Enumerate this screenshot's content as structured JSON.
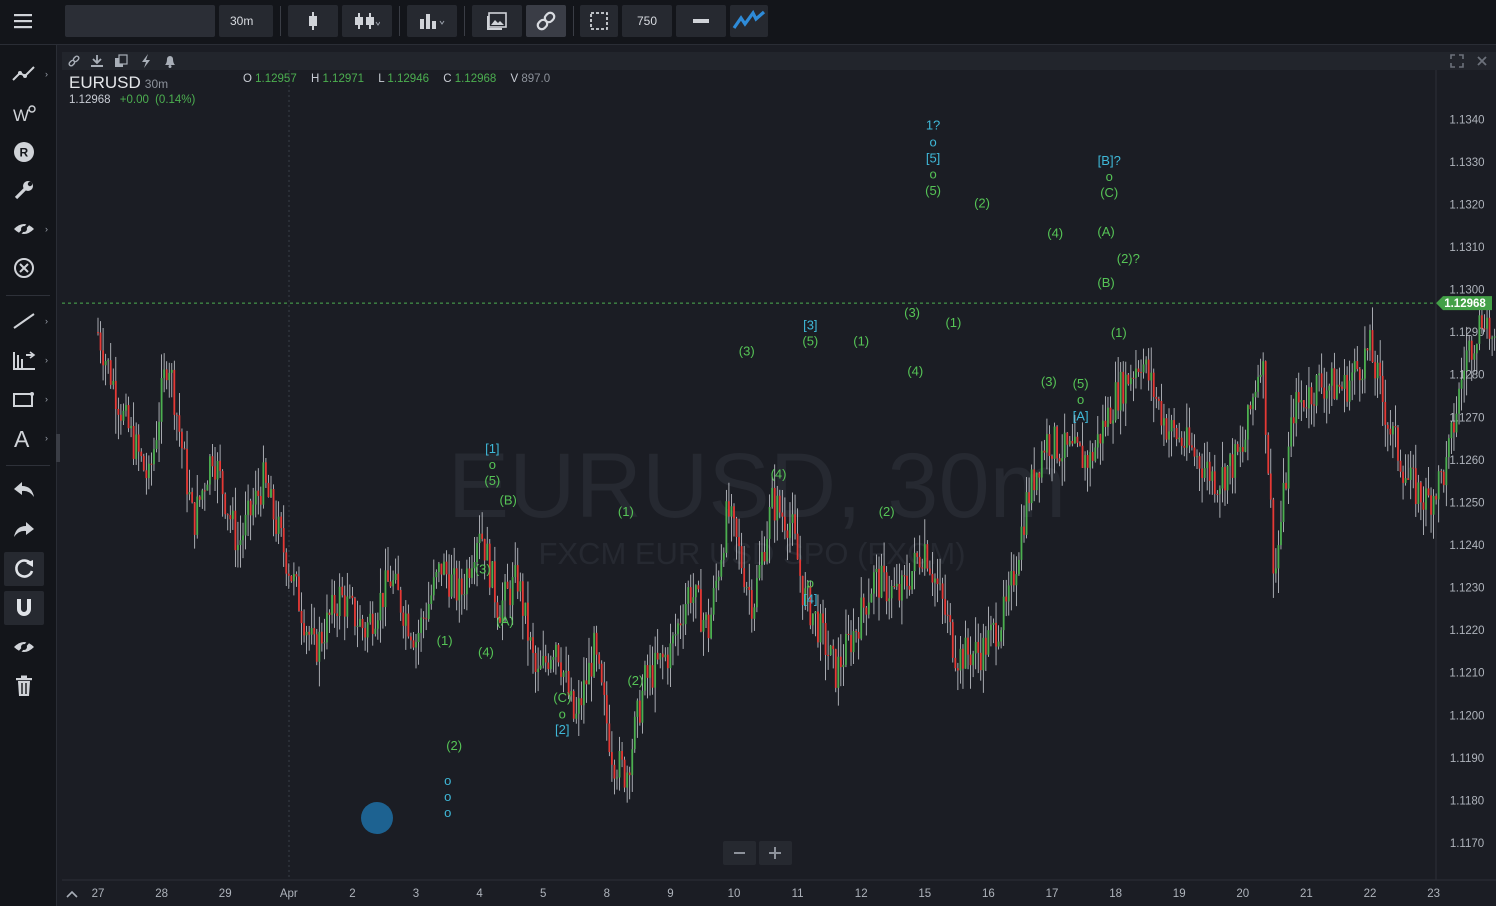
{
  "toolbar": {
    "symbol_input_value": "",
    "interval": "30m",
    "bars_count": "750"
  },
  "chart": {
    "symbol": "EURUSD",
    "timeframe": "30m",
    "last_price": "1.12968",
    "change": "+0.00",
    "change_pct": "(0.14%)",
    "ohlc": {
      "o_label": "O",
      "o": "1.12957",
      "h_label": "H",
      "h": "1.12971",
      "l_label": "L",
      "l": "1.12946",
      "c_label": "C",
      "c": "1.12968",
      "v_label": "V",
      "v": "897.0"
    },
    "watermark_title": "EURUSD, 30m",
    "watermark_subtitle": "FXCM EUR USD SPO (FXCM)",
    "price_tag": "1.12968",
    "colors": {
      "up": "#4caf50",
      "down": "#e53935",
      "wave_green": "#56c456",
      "wave_cyan": "#3fb8d8",
      "background": "#1b1d24"
    }
  },
  "chart_data": {
    "type": "candlestick",
    "y_ticks": [
      "1.1340",
      "1.1330",
      "1.1320",
      "1.1310",
      "1.1300",
      "1.1290",
      "1.1280",
      "1.1270",
      "1.1260",
      "1.1250",
      "1.1240",
      "1.1230",
      "1.1220",
      "1.1210",
      "1.1200",
      "1.1190",
      "1.1180",
      "1.1170"
    ],
    "ylim": [
      1.1166,
      1.1345
    ],
    "x_ticks": [
      "27",
      "28",
      "29",
      "Apr",
      "2",
      "3",
      "4",
      "5",
      "8",
      "9",
      "10",
      "11",
      "12",
      "15",
      "16",
      "17",
      "18",
      "19",
      "20",
      "21",
      "22",
      "23"
    ],
    "path_points": [
      [
        0,
        1.129
      ],
      [
        0.4,
        1.127
      ],
      [
        0.8,
        1.1255
      ],
      [
        1.1,
        1.1285
      ],
      [
        1.5,
        1.1245
      ],
      [
        1.8,
        1.1262
      ],
      [
        2.2,
        1.124
      ],
      [
        2.6,
        1.1255
      ],
      [
        3.0,
        1.1235
      ],
      [
        3.4,
        1.1215
      ],
      [
        3.8,
        1.1228
      ],
      [
        4.2,
        1.122
      ],
      [
        4.6,
        1.1232
      ],
      [
        5.0,
        1.1218
      ],
      [
        5.4,
        1.1235
      ],
      [
        5.7,
        1.1228
      ],
      [
        6.0,
        1.1245
      ],
      [
        6.3,
        1.1225
      ],
      [
        6.6,
        1.1232
      ],
      [
        6.9,
        1.1208
      ],
      [
        7.2,
        1.1218
      ],
      [
        7.5,
        1.1198
      ],
      [
        7.8,
        1.1215
      ],
      [
        8.1,
        1.119
      ],
      [
        8.3,
        1.1186
      ],
      [
        8.6,
        1.1208
      ],
      [
        9.0,
        1.1215
      ],
      [
        9.3,
        1.123
      ],
      [
        9.6,
        1.122
      ],
      [
        9.9,
        1.1248
      ],
      [
        10.3,
        1.1226
      ],
      [
        10.6,
        1.125
      ],
      [
        10.9,
        1.1245
      ],
      [
        11.1,
        1.1228
      ],
      [
        11.3,
        1.1222
      ],
      [
        11.6,
        1.121
      ],
      [
        11.9,
        1.122
      ],
      [
        12.2,
        1.1232
      ],
      [
        12.6,
        1.1228
      ],
      [
        13.0,
        1.124
      ],
      [
        13.3,
        1.1225
      ],
      [
        13.5,
        1.1214
      ],
      [
        13.9,
        1.1215
      ],
      [
        14.3,
        1.1225
      ],
      [
        14.6,
        1.125
      ],
      [
        14.9,
        1.1265
      ],
      [
        15.2,
        1.1262
      ],
      [
        15.6,
        1.126
      ],
      [
        16.0,
        1.1275
      ],
      [
        16.4,
        1.1284
      ],
      [
        16.8,
        1.1268
      ],
      [
        17.2,
        1.1262
      ],
      [
        17.6,
        1.1255
      ],
      [
        18.0,
        1.1262
      ],
      [
        18.3,
        1.1286
      ],
      [
        18.5,
        1.1232
      ],
      [
        18.8,
        1.1272
      ],
      [
        19.2,
        1.1278
      ],
      [
        19.6,
        1.1277
      ],
      [
        20.0,
        1.1286
      ],
      [
        20.3,
        1.1268
      ],
      [
        20.6,
        1.1255
      ],
      [
        20.9,
        1.125
      ],
      [
        21.2,
        1.1258
      ],
      [
        21.5,
        1.1284
      ],
      [
        21.8,
        1.1295
      ],
      [
        22.0,
        1.1282
      ],
      [
        22.3,
        1.131
      ],
      [
        22.6,
        1.1322
      ],
      [
        22.9,
        1.1305
      ],
      [
        23.2,
        1.1292
      ],
      [
        23.5,
        1.13
      ],
      [
        23.9,
        1.1312
      ],
      [
        24.2,
        1.132
      ],
      [
        24.5,
        1.131
      ],
      [
        24.9,
        1.1305
      ],
      [
        25.3,
        1.13
      ],
      [
        25.6,
        1.1296
      ],
      [
        26.0,
        1.1308
      ],
      [
        26.2,
        1.1312
      ],
      [
        26.5,
        1.129
      ],
      [
        26.8,
        1.128
      ],
      [
        27.1,
        1.1283
      ],
      [
        27.4,
        1.1285
      ],
      [
        27.7,
        1.128
      ],
      [
        28.0,
        1.13
      ],
      [
        28.3,
        1.1312
      ],
      [
        28.5,
        1.132
      ],
      [
        28.8,
        1.1305
      ],
      [
        29.1,
        1.1298
      ],
      [
        29.4,
        1.1296
      ]
    ],
    "wave_labels": [
      {
        "text": "1?",
        "x": 13.13,
        "y": 1.13385,
        "color": "cyan"
      },
      {
        "text": "o",
        "x": 13.13,
        "y": 1.13345,
        "color": "cyan"
      },
      {
        "text": "[5]",
        "x": 13.13,
        "y": 1.13308,
        "color": "cyan"
      },
      {
        "text": "o",
        "x": 13.13,
        "y": 1.1327,
        "color": "green"
      },
      {
        "text": "(5)",
        "x": 13.13,
        "y": 1.13232,
        "color": "green"
      },
      {
        "text": "(2)",
        "x": 13.9,
        "y": 1.13202,
        "color": "green"
      },
      {
        "text": "[B]?",
        "x": 15.9,
        "y": 1.13302,
        "color": "cyan"
      },
      {
        "text": "o",
        "x": 15.9,
        "y": 1.13265,
        "color": "green"
      },
      {
        "text": "(C)",
        "x": 15.9,
        "y": 1.13227,
        "color": "green"
      },
      {
        "text": "(A)",
        "x": 15.85,
        "y": 1.13135,
        "color": "green"
      },
      {
        "text": "(2)?",
        "x": 16.2,
        "y": 1.13072,
        "color": "green"
      },
      {
        "text": "(B)",
        "x": 15.85,
        "y": 1.13015,
        "color": "green"
      },
      {
        "text": "(4)",
        "x": 15.05,
        "y": 1.13132,
        "color": "green"
      },
      {
        "text": "(1)",
        "x": 16.05,
        "y": 1.12898,
        "color": "green"
      },
      {
        "text": "(3)",
        "x": 14.95,
        "y": 1.12783,
        "color": "green"
      },
      {
        "text": "(5)",
        "x": 15.45,
        "y": 1.12778,
        "color": "green"
      },
      {
        "text": "o",
        "x": 15.45,
        "y": 1.1274,
        "color": "green"
      },
      {
        "text": "[A]",
        "x": 15.45,
        "y": 1.12702,
        "color": "cyan"
      },
      {
        "text": "(1)",
        "x": 13.45,
        "y": 1.12922,
        "color": "green"
      },
      {
        "text": "(3)",
        "x": 12.8,
        "y": 1.12945,
        "color": "green"
      },
      {
        "text": "(4)",
        "x": 12.85,
        "y": 1.12808,
        "color": "green"
      },
      {
        "text": "[3]",
        "x": 11.2,
        "y": 1.12915,
        "color": "cyan"
      },
      {
        "text": "(5)",
        "x": 11.2,
        "y": 1.12878,
        "color": "green"
      },
      {
        "text": "(1)",
        "x": 12.0,
        "y": 1.12878,
        "color": "green"
      },
      {
        "text": "(3)",
        "x": 10.2,
        "y": 1.12855,
        "color": "green"
      },
      {
        "text": "(4)",
        "x": 10.7,
        "y": 1.12565,
        "color": "green"
      },
      {
        "text": "(2)",
        "x": 12.4,
        "y": 1.12478,
        "color": "green"
      },
      {
        "text": "o",
        "x": 11.2,
        "y": 1.1231,
        "color": "green"
      },
      {
        "text": "[4]",
        "x": 11.2,
        "y": 1.12272,
        "color": "cyan"
      },
      {
        "text": "[1]",
        "x": 6.2,
        "y": 1.12625,
        "color": "cyan"
      },
      {
        "text": "o",
        "x": 6.2,
        "y": 1.12588,
        "color": "green"
      },
      {
        "text": "(5)",
        "x": 6.2,
        "y": 1.1255,
        "color": "green"
      },
      {
        "text": "(B)",
        "x": 6.45,
        "y": 1.12505,
        "color": "green"
      },
      {
        "text": "(3)",
        "x": 6.05,
        "y": 1.12342,
        "color": "green"
      },
      {
        "text": "(A)",
        "x": 6.4,
        "y": 1.1222,
        "color": "green"
      },
      {
        "text": "(4)",
        "x": 6.1,
        "y": 1.12148,
        "color": "green"
      },
      {
        "text": "(1)",
        "x": 5.45,
        "y": 1.12175,
        "color": "green"
      },
      {
        "text": "(2)",
        "x": 5.6,
        "y": 1.11928,
        "color": "green"
      },
      {
        "text": "(1)",
        "x": 8.3,
        "y": 1.12478,
        "color": "green"
      },
      {
        "text": "(C)",
        "x": 7.3,
        "y": 1.1204,
        "color": "green"
      },
      {
        "text": "o",
        "x": 7.3,
        "y": 1.12002,
        "color": "green"
      },
      {
        "text": "[2]",
        "x": 7.3,
        "y": 1.11965,
        "color": "cyan"
      },
      {
        "text": "(2)",
        "x": 8.45,
        "y": 1.1208,
        "color": "green"
      },
      {
        "text": "o",
        "x": 5.5,
        "y": 1.11845,
        "color": "cyan"
      },
      {
        "text": "o",
        "x": 5.5,
        "y": 1.11808,
        "color": "cyan"
      },
      {
        "text": "o",
        "x": 5.5,
        "y": 1.1177,
        "color": "cyan"
      }
    ]
  }
}
